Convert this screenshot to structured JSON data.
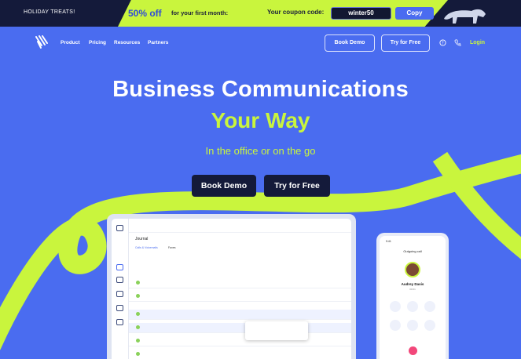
{
  "promo": {
    "left_text": "HOLIDAY TREATS!",
    "percent": "50% off",
    "first_month": "for your first month:",
    "coupon_label": "Your coupon code:",
    "coupon_code": "winter50",
    "copy_label": "Copy"
  },
  "nav": {
    "links": [
      "Product",
      "Pricing",
      "Resources",
      "Partners"
    ],
    "book_demo": "Book Demo",
    "try_free": "Try for Free",
    "login": "Login"
  },
  "hero": {
    "title": "Business Communications",
    "title_accent": "Your Way",
    "subtitle": "In the office or on the go",
    "cta_demo": "Book Demo",
    "cta_try": "Try for Free"
  },
  "desktop_app": {
    "page_title": "Journal",
    "tabs": [
      "Calls & Voicemails",
      "Faxes"
    ]
  },
  "phone_app": {
    "time": "9:41",
    "header": "Outgoing call",
    "contact_name": "Audrey Davis",
    "contact_sub": "00:01"
  },
  "colors": {
    "brand_blue": "#4a6cf0",
    "accent_lime": "#c9f53d",
    "dark_navy": "#141a3a"
  }
}
